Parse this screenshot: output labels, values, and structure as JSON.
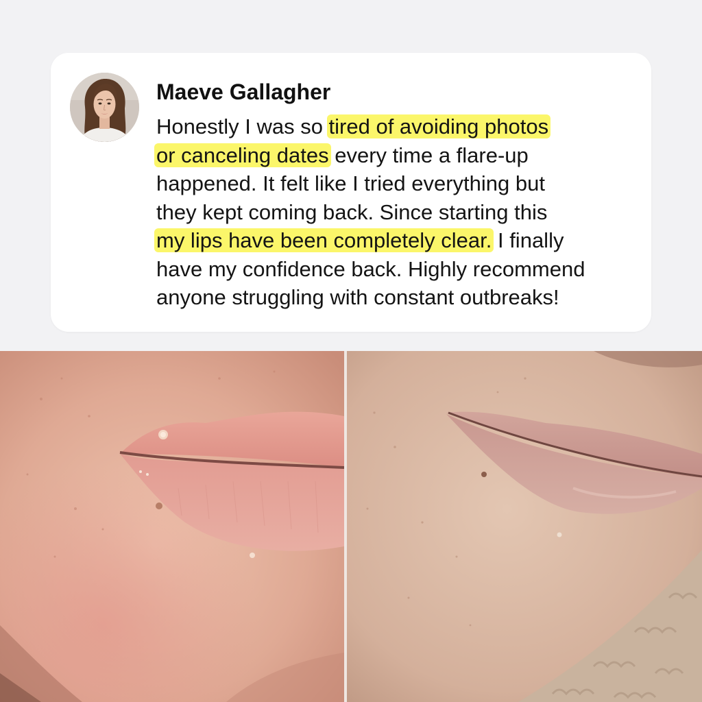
{
  "review": {
    "author": "Maeve Gallagher",
    "lines": [
      [
        {
          "text": "Honestly I was so ",
          "highlight": false
        },
        {
          "text": "tired of avoiding photos",
          "highlight": true
        }
      ],
      [
        {
          "text": "or canceling dates",
          "highlight": true
        },
        {
          "text": " every time a flare-up",
          "highlight": false
        }
      ],
      [
        {
          "text": "happened. It felt like I tried everything but",
          "highlight": false
        }
      ],
      [
        {
          "text": "they kept coming back. Since starting this",
          "highlight": false
        }
      ],
      [
        {
          "text": "my lips have been completely clear.",
          "highlight": true
        },
        {
          "text": " I finally",
          "highlight": false
        }
      ],
      [
        {
          "text": "have my confidence back. Highly recommend",
          "highlight": false
        }
      ],
      [
        {
          "text": "anyone struggling with constant outbreaks!",
          "highlight": false
        }
      ]
    ]
  },
  "colors": {
    "highlight": "#fbf66a",
    "background": "#f2f2f4",
    "card": "#ffffff"
  },
  "photos": {
    "before": {
      "label": ""
    },
    "after": {
      "label": ""
    }
  }
}
